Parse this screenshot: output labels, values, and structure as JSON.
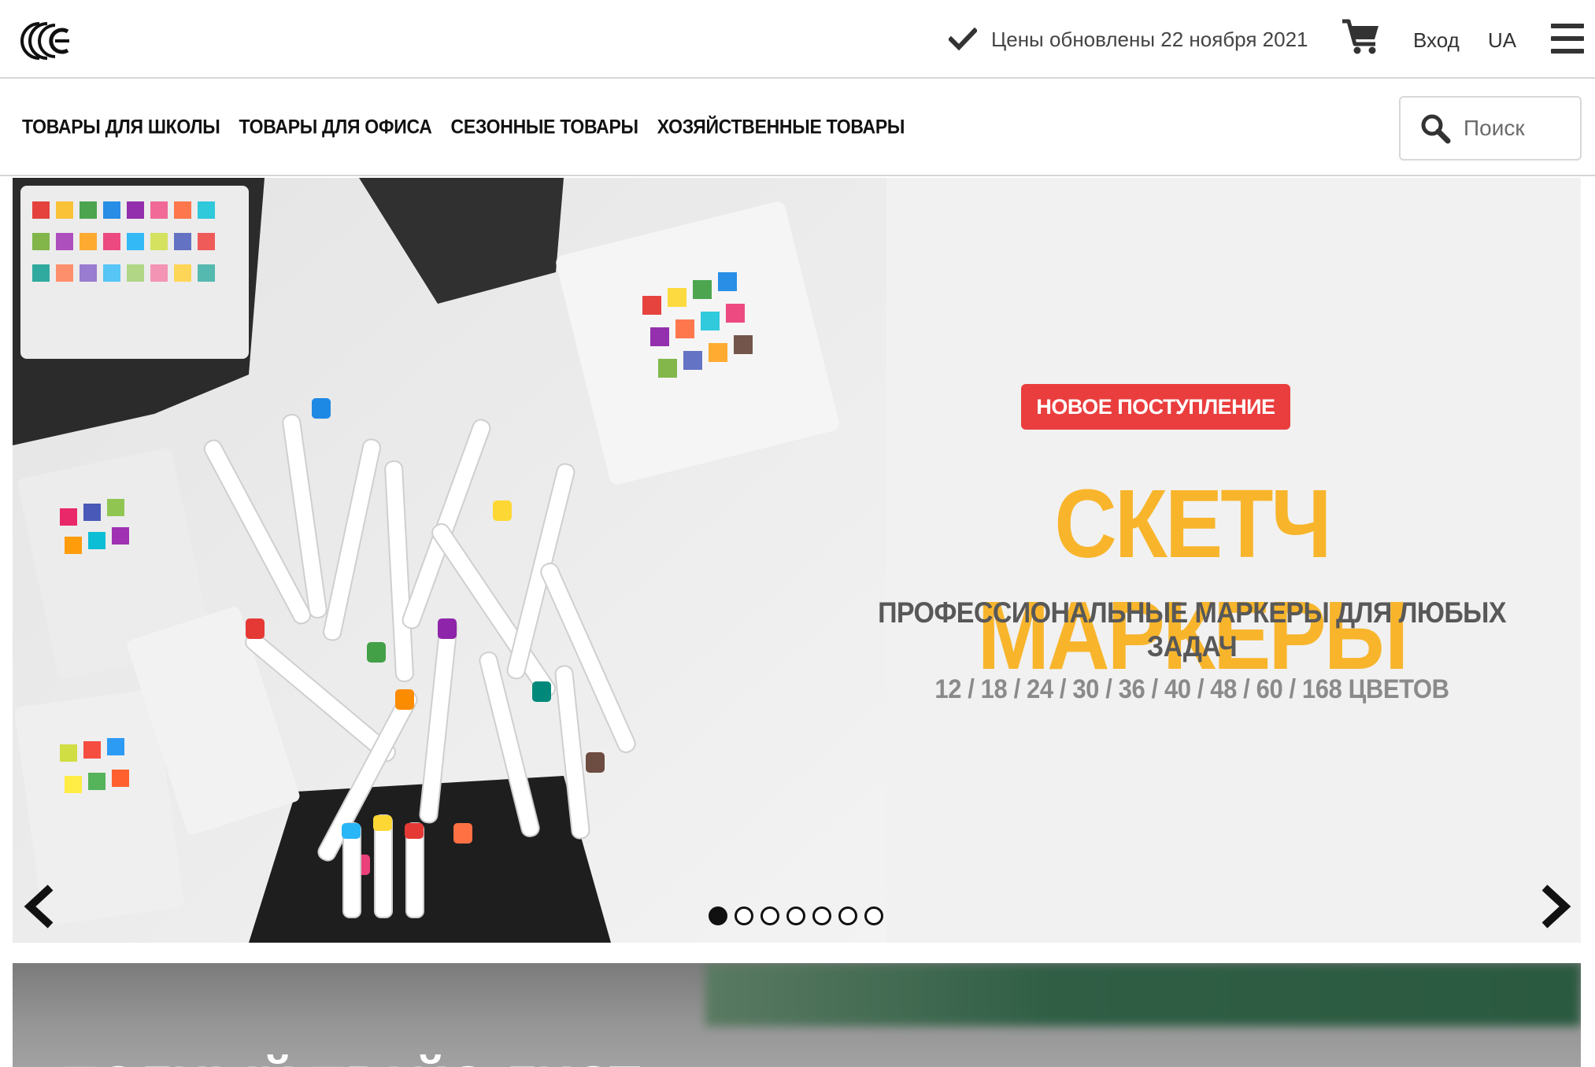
{
  "header": {
    "logo": "logo-icon",
    "prices_updated": "Цены обновлены 22 ноября 2021",
    "cart_icon": "cart-icon",
    "login_label": "Вход",
    "lang_label": "UA",
    "menu_icon": "hamburger-menu-icon"
  },
  "nav": {
    "items": [
      {
        "label": "ТОВАРЫ ДЛЯ ШКОЛЫ"
      },
      {
        "label": "ТОВАРЫ ДЛЯ ОФИСА"
      },
      {
        "label": "СЕЗОННЫЕ ТОВАРЫ"
      },
      {
        "label": "ХОЗЯЙСТВЕННЫЕ ТОВАРЫ"
      }
    ],
    "search_placeholder": "Поиск"
  },
  "banner": {
    "badge": "НОВОЕ ПОСТУПЛЕНИЕ",
    "headline": "СКЕТЧ МАРКЕРЫ",
    "subline": "ПРОФЕССИОНАЛЬНЫЕ МАРКЕРЫ ДЛЯ ЛЮБЫХ ЗАДАЧ",
    "colors_line": "12 / 18 / 24 / 30 / 36 / 40 / 48 / 60 / 168 ЦВЕТОВ",
    "slides_total": 7,
    "active_slide": 1,
    "accent_badge": "#ea3e3e",
    "accent_headline": "#f8b52c"
  },
  "banner2": {
    "title": "ПОЛНЫЙ ПРАЙС-ЛИСТ"
  }
}
